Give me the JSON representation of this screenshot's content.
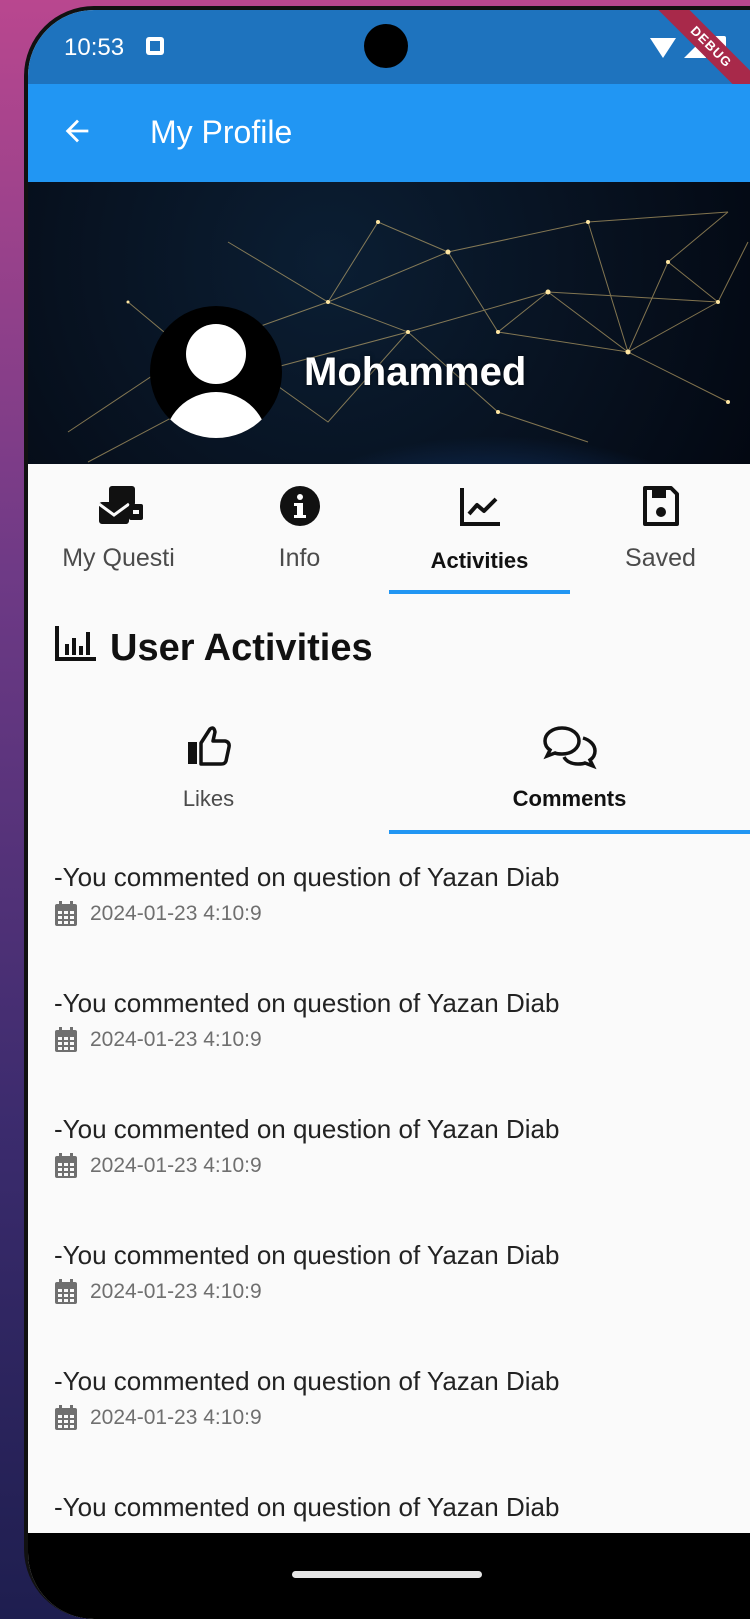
{
  "status_bar": {
    "time": "10:53",
    "debug_banner": "DEBUG"
  },
  "app_bar": {
    "title": "My Profile",
    "back_icon": "arrow-left-icon"
  },
  "profile": {
    "name": "Mohammed"
  },
  "tabs": [
    {
      "label": "My Questi",
      "icon": "envelope-stack-icon",
      "active": false
    },
    {
      "label": "Info",
      "icon": "info-circle-icon",
      "active": false
    },
    {
      "label": "Activities",
      "icon": "line-chart-icon",
      "active": true
    },
    {
      "label": "Saved",
      "icon": "floppy-disk-icon",
      "active": false
    }
  ],
  "section": {
    "title": "User Activities",
    "icon": "bar-chart-icon"
  },
  "subtabs": [
    {
      "label": "Likes",
      "icon": "thumbs-up-icon",
      "active": false
    },
    {
      "label": "Comments",
      "icon": "comments-icon",
      "active": true
    }
  ],
  "activities": [
    {
      "text": "-You commented on question of Yazan Diab",
      "date": "2024-01-23 4:10:9"
    },
    {
      "text": "-You commented on question of Yazan Diab",
      "date": "2024-01-23 4:10:9"
    },
    {
      "text": "-You commented on question of Yazan Diab",
      "date": "2024-01-23 4:10:9"
    },
    {
      "text": "-You commented on question of Yazan Diab",
      "date": "2024-01-23 4:10:9"
    },
    {
      "text": "-You commented on question of Yazan Diab",
      "date": "2024-01-23 4:10:9"
    },
    {
      "text": "-You commented on question of Yazan Diab",
      "date": ""
    }
  ],
  "colors": {
    "primary": "#2196f3",
    "status_bar": "#1e73be",
    "background": "#fafafa"
  }
}
